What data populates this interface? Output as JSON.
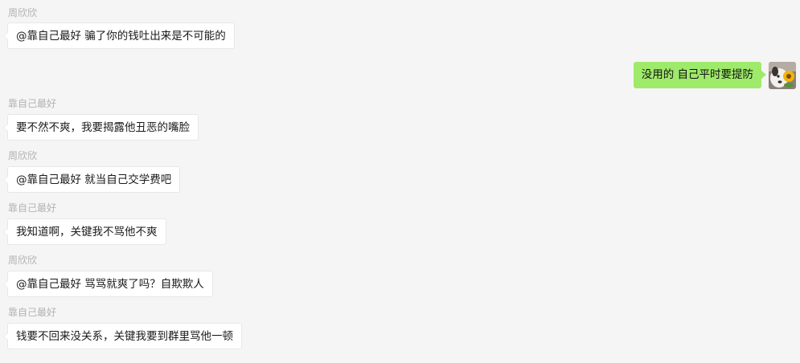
{
  "messages": [
    {
      "sender": "周欣欣",
      "text": "@靠自己最好 骗了你的钱吐出来是不可能的",
      "direction": "in"
    },
    {
      "sender": "",
      "text": "没用的  自己平时要提防",
      "direction": "out"
    },
    {
      "sender": "靠自己最好",
      "text": "要不然不爽，我要揭露他丑恶的嘴脸",
      "direction": "in"
    },
    {
      "sender": "周欣欣",
      "text": "@靠自己最好 就当自己交学费吧",
      "direction": "in"
    },
    {
      "sender": "靠自己最好",
      "text": "我知道啊，关键我不骂他不爽",
      "direction": "in"
    },
    {
      "sender": "周欣欣",
      "text": "@靠自己最好 骂骂就爽了吗？自欺欺人",
      "direction": "in"
    },
    {
      "sender": "靠自己最好",
      "text": "钱要不回来没关系，关键我要到群里骂他一顿",
      "direction": "in"
    }
  ],
  "colors": {
    "background": "#f5f5f5",
    "incoming_bubble": "#ffffff",
    "outgoing_bubble": "#9eea6a",
    "sender_name": "#b2b2b2"
  },
  "avatar": {
    "icon": "dog-with-sunflower-avatar"
  }
}
